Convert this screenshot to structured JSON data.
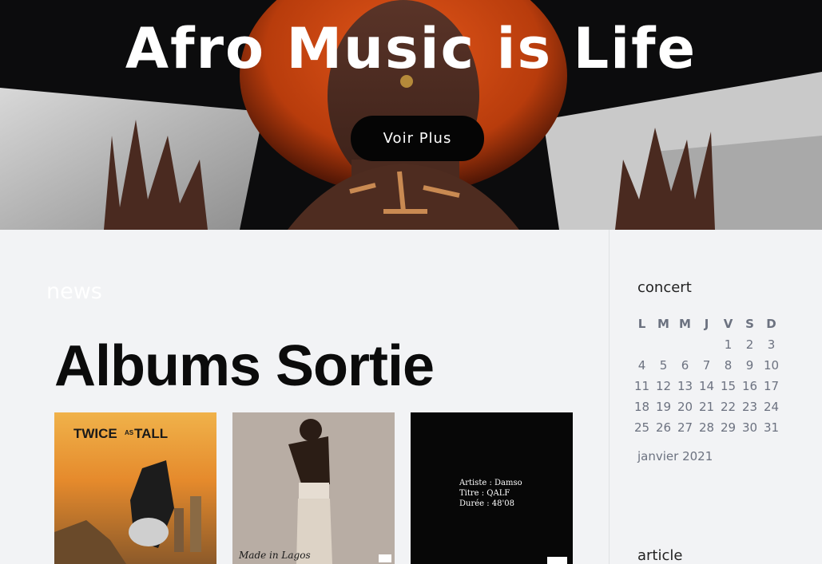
{
  "hero": {
    "title": "Afro Music is Life",
    "button_label": "Voir Plus"
  },
  "news": {
    "label": "news",
    "title": "Albums Sortie",
    "albums": [
      {
        "cover_title": "TWICE",
        "cover_sub": "AS",
        "cover_title2": "TALL"
      },
      {
        "cover_title": "Made in Lagos"
      },
      {
        "line1": "Artiste : Damso",
        "line2": "Titre : QALF",
        "line3": "Durée : 48'08"
      }
    ]
  },
  "sidebar": {
    "concert_heading": "concert",
    "calendar": {
      "weekdays": [
        "L",
        "M",
        "M",
        "J",
        "V",
        "S",
        "D"
      ],
      "weeks": [
        [
          "",
          "",
          "",
          "",
          "1",
          "2",
          "3"
        ],
        [
          "4",
          "5",
          "6",
          "7",
          "8",
          "9",
          "10"
        ],
        [
          "11",
          "12",
          "13",
          "14",
          "15",
          "16",
          "17"
        ],
        [
          "18",
          "19",
          "20",
          "21",
          "22",
          "23",
          "24"
        ],
        [
          "25",
          "26",
          "27",
          "28",
          "29",
          "30",
          "31"
        ]
      ],
      "caption": "janvier 2021"
    },
    "article_heading": "article"
  }
}
